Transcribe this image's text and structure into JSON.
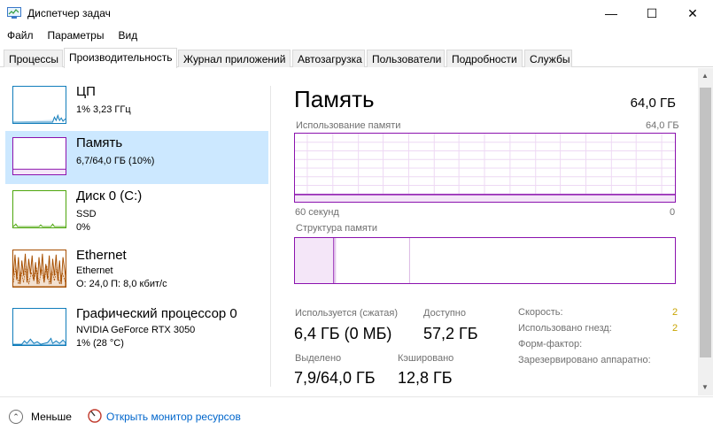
{
  "window": {
    "title": "Диспетчер задач",
    "min_glyph": "—",
    "max_glyph": "☐",
    "close_glyph": "✕"
  },
  "menu": [
    "Файл",
    "Параметры",
    "Вид"
  ],
  "tabs": [
    "Процессы",
    "Производительность",
    "Журнал приложений",
    "Автозагрузка",
    "Пользователи",
    "Подробности",
    "Службы"
  ],
  "active_tab": "Производительность",
  "devices": [
    {
      "name": "ЦП",
      "line1": "1% 3,23 ГГц",
      "line2": "",
      "color": "#117dbb"
    },
    {
      "name": "Память",
      "line1": "6,7/64,0 ГБ (10%)",
      "line2": "",
      "color": "#8b12ae",
      "selected": true
    },
    {
      "name": "Диск 0 (C:)",
      "line1": "SSD",
      "line2": "0%",
      "color": "#4da60c"
    },
    {
      "name": "Ethernet",
      "line1": "Ethernet",
      "line2": "О: 24,0 П: 8,0 кбит/с",
      "color": "#a74f01"
    },
    {
      "name": "Графический процессор 0",
      "line1": "NVIDIA GeForce RTX 3050",
      "line2": "1% (28 °C)",
      "color": "#117dbb"
    }
  ],
  "main": {
    "title": "Память",
    "total": "64,0 ГБ",
    "usage_label": "Использование памяти",
    "usage_max": "64,0 ГБ",
    "time_label": "60 секунд",
    "time_zero": "0",
    "structure_label": "Структура памяти",
    "usage_fraction": 0.105,
    "stats": {
      "in_use_label": "Используется (сжатая)",
      "in_use": "6,4 ГБ (0 МБ)",
      "available_label": "Доступно",
      "available": "57,2 ГБ",
      "committed_label": "Выделено",
      "committed": "7,9/64,0 ГБ",
      "cached_label": "Кэшировано",
      "cached": "12,8 ГБ"
    },
    "props": [
      {
        "label": "Скорость:",
        "value": "2"
      },
      {
        "label": "Использовано гнезд:",
        "value": "2"
      },
      {
        "label": "Форм-фактор:",
        "value": ""
      },
      {
        "label": "Зарезервировано аппаратно:",
        "value": ""
      }
    ]
  },
  "footer": {
    "fewer": "Меньше",
    "resource_monitor": "Открыть монитор ресурсов"
  },
  "colors": {
    "memory": "#8b12ae",
    "selected_bg": "#cce8ff",
    "link": "#0066cc"
  }
}
